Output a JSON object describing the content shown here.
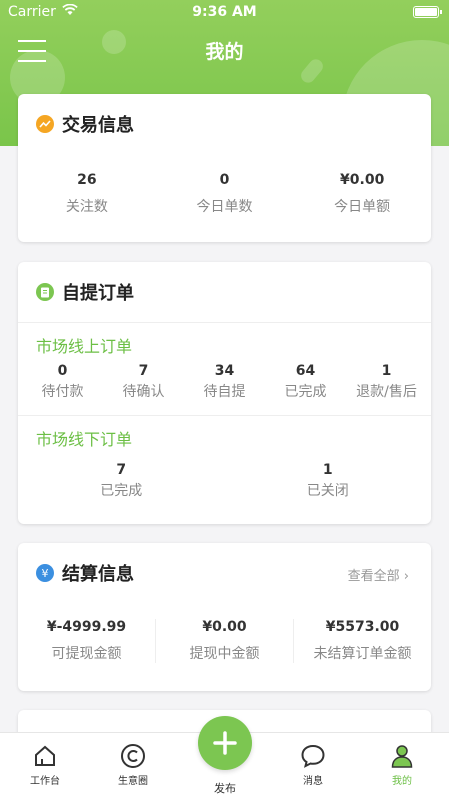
{
  "status": {
    "carrier": "Carrier",
    "time": "9:36 AM"
  },
  "header": {
    "title": "我的"
  },
  "trade": {
    "title": "交易信息",
    "stats": [
      {
        "value": "26",
        "label": "关注数"
      },
      {
        "value": "0",
        "label": "今日单数"
      },
      {
        "value": "¥0.00",
        "label": "今日单额"
      }
    ]
  },
  "pickup": {
    "title": "自提订单",
    "online_title": "市场线上订单",
    "online": [
      {
        "value": "0",
        "label": "待付款"
      },
      {
        "value": "7",
        "label": "待确认"
      },
      {
        "value": "34",
        "label": "待自提"
      },
      {
        "value": "64",
        "label": "已完成"
      },
      {
        "value": "1",
        "label": "退款/售后"
      }
    ],
    "offline_title": "市场线下订单",
    "offline": [
      {
        "value": "7",
        "label": "已完成"
      },
      {
        "value": "1",
        "label": "已关闭"
      }
    ]
  },
  "settle": {
    "title": "结算信息",
    "more": "查看全部",
    "stats": [
      {
        "value": "¥-4999.99",
        "label": "可提现金额"
      },
      {
        "value": "¥0.00",
        "label": "提现中金额"
      },
      {
        "value": "¥5573.00",
        "label": "未结算订单金额"
      }
    ]
  },
  "tabs": {
    "workbench": "工作台",
    "circle": "生意圈",
    "publish": "发布",
    "messages": "消息",
    "mine": "我的"
  },
  "colors": {
    "accent": "#7ac54a",
    "trade_icon": "#f5a623",
    "pickup_icon": "#7cc651",
    "settle_icon": "#3b8fe0"
  }
}
